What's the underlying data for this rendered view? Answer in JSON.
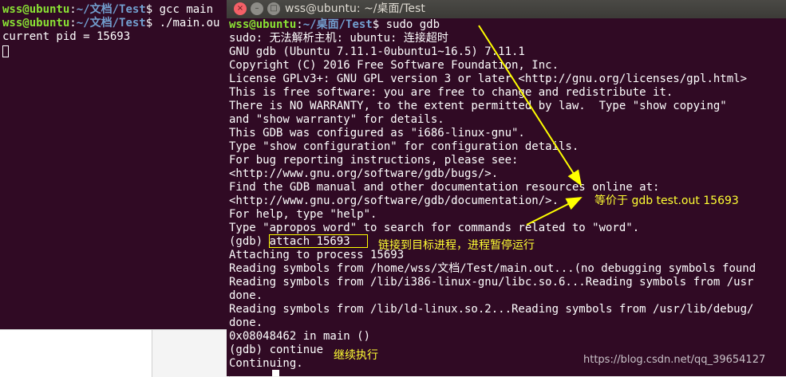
{
  "back_terminal": {
    "lines": [
      {
        "user": "wss@ubuntu",
        "sep": ":",
        "path": "~/文档/Test",
        "cmd": "$ gcc main"
      },
      {
        "user": "wss@ubuntu",
        "sep": ":",
        "path": "~/文档/Test",
        "cmd": "$ ./main.ou"
      },
      {
        "text": "current pid = 15693"
      }
    ]
  },
  "front_window": {
    "title": "wss@ubuntu: ~/桌面/Test",
    "buttons": {
      "close": "×",
      "minimize": "–",
      "maximize": "□"
    },
    "prompt": {
      "user": "wss@ubuntu",
      "sep": ":",
      "path": "~/桌面/Test",
      "cmd": "$ sudo gdb"
    },
    "lines": [
      "sudo: 无法解析主机: ubuntu: 连接超时",
      "GNU gdb (Ubuntu 7.11.1-0ubuntu1~16.5) 7.11.1",
      "Copyright (C) 2016 Free Software Foundation, Inc.",
      "License GPLv3+: GNU GPL version 3 or later <http://gnu.org/licenses/gpl.html>",
      "This is free software: you are free to change and redistribute it.",
      "There is NO WARRANTY, to the extent permitted by law.  Type \"show copying\"",
      "and \"show warranty\" for details.",
      "This GDB was configured as \"i686-linux-gnu\".",
      "Type \"show configuration\" for configuration details.",
      "For bug reporting instructions, please see:",
      "<http://www.gnu.org/software/gdb/bugs/>.",
      "Find the GDB manual and other documentation resources online at:",
      "<http://www.gnu.org/software/gdb/documentation/>.",
      "For help, type \"help\".",
      "Type \"apropos word\" to search for commands related to \"word\".",
      "(gdb) attach 15693",
      "Attaching to process 15693",
      "Reading symbols from /home/wss/文档/Test/main.out...(no debugging symbols found",
      "Reading symbols from /lib/i386-linux-gnu/libc.so.6...Reading symbols from /usr",
      "done.",
      "Reading symbols from /lib/ld-linux.so.2...Reading symbols from /usr/lib/debug/",
      "done.",
      "0x08048462 in main ()",
      "(gdb) continue",
      "Continuing."
    ]
  },
  "annotations": {
    "equivalent": "等价于 gdb test.out 15693",
    "attach_note": "链接到目标进程，进程暂停运行",
    "continue_note": "继续执行"
  },
  "watermark": "https://blog.csdn.net/qq_39654127",
  "colors": {
    "terminal_bg": "#300a24",
    "prompt_user": "#8ae234",
    "prompt_path": "#729fcf",
    "annotation": "#ffff00"
  }
}
